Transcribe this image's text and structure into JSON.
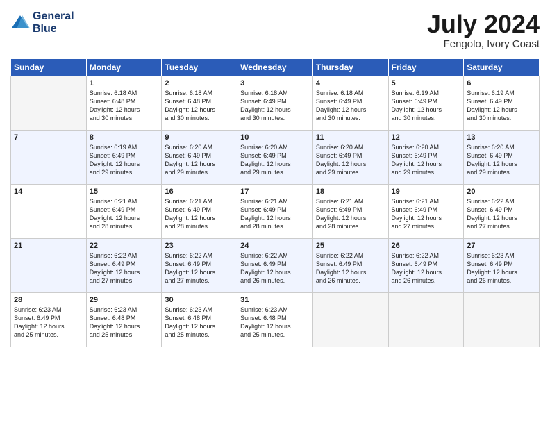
{
  "header": {
    "logo_line1": "General",
    "logo_line2": "Blue",
    "title": "July 2024",
    "location": "Fengolo, Ivory Coast"
  },
  "days_of_week": [
    "Sunday",
    "Monday",
    "Tuesday",
    "Wednesday",
    "Thursday",
    "Friday",
    "Saturday"
  ],
  "weeks": [
    [
      {
        "num": "",
        "info": ""
      },
      {
        "num": "1",
        "info": "Sunrise: 6:18 AM\nSunset: 6:48 PM\nDaylight: 12 hours\nand 30 minutes."
      },
      {
        "num": "2",
        "info": "Sunrise: 6:18 AM\nSunset: 6:48 PM\nDaylight: 12 hours\nand 30 minutes."
      },
      {
        "num": "3",
        "info": "Sunrise: 6:18 AM\nSunset: 6:49 PM\nDaylight: 12 hours\nand 30 minutes."
      },
      {
        "num": "4",
        "info": "Sunrise: 6:18 AM\nSunset: 6:49 PM\nDaylight: 12 hours\nand 30 minutes."
      },
      {
        "num": "5",
        "info": "Sunrise: 6:19 AM\nSunset: 6:49 PM\nDaylight: 12 hours\nand 30 minutes."
      },
      {
        "num": "6",
        "info": "Sunrise: 6:19 AM\nSunset: 6:49 PM\nDaylight: 12 hours\nand 30 minutes."
      }
    ],
    [
      {
        "num": "7",
        "info": ""
      },
      {
        "num": "8",
        "info": "Sunrise: 6:19 AM\nSunset: 6:49 PM\nDaylight: 12 hours\nand 29 minutes."
      },
      {
        "num": "9",
        "info": "Sunrise: 6:20 AM\nSunset: 6:49 PM\nDaylight: 12 hours\nand 29 minutes."
      },
      {
        "num": "10",
        "info": "Sunrise: 6:20 AM\nSunset: 6:49 PM\nDaylight: 12 hours\nand 29 minutes."
      },
      {
        "num": "11",
        "info": "Sunrise: 6:20 AM\nSunset: 6:49 PM\nDaylight: 12 hours\nand 29 minutes."
      },
      {
        "num": "12",
        "info": "Sunrise: 6:20 AM\nSunset: 6:49 PM\nDaylight: 12 hours\nand 29 minutes."
      },
      {
        "num": "13",
        "info": "Sunrise: 6:20 AM\nSunset: 6:49 PM\nDaylight: 12 hours\nand 29 minutes."
      }
    ],
    [
      {
        "num": "14",
        "info": ""
      },
      {
        "num": "15",
        "info": "Sunrise: 6:21 AM\nSunset: 6:49 PM\nDaylight: 12 hours\nand 28 minutes."
      },
      {
        "num": "16",
        "info": "Sunrise: 6:21 AM\nSunset: 6:49 PM\nDaylight: 12 hours\nand 28 minutes."
      },
      {
        "num": "17",
        "info": "Sunrise: 6:21 AM\nSunset: 6:49 PM\nDaylight: 12 hours\nand 28 minutes."
      },
      {
        "num": "18",
        "info": "Sunrise: 6:21 AM\nSunset: 6:49 PM\nDaylight: 12 hours\nand 28 minutes."
      },
      {
        "num": "19",
        "info": "Sunrise: 6:21 AM\nSunset: 6:49 PM\nDaylight: 12 hours\nand 27 minutes."
      },
      {
        "num": "20",
        "info": "Sunrise: 6:22 AM\nSunset: 6:49 PM\nDaylight: 12 hours\nand 27 minutes."
      }
    ],
    [
      {
        "num": "21",
        "info": ""
      },
      {
        "num": "22",
        "info": "Sunrise: 6:22 AM\nSunset: 6:49 PM\nDaylight: 12 hours\nand 27 minutes."
      },
      {
        "num": "23",
        "info": "Sunrise: 6:22 AM\nSunset: 6:49 PM\nDaylight: 12 hours\nand 27 minutes."
      },
      {
        "num": "24",
        "info": "Sunrise: 6:22 AM\nSunset: 6:49 PM\nDaylight: 12 hours\nand 26 minutes."
      },
      {
        "num": "25",
        "info": "Sunrise: 6:22 AM\nSunset: 6:49 PM\nDaylight: 12 hours\nand 26 minutes."
      },
      {
        "num": "26",
        "info": "Sunrise: 6:22 AM\nSunset: 6:49 PM\nDaylight: 12 hours\nand 26 minutes."
      },
      {
        "num": "27",
        "info": "Sunrise: 6:23 AM\nSunset: 6:49 PM\nDaylight: 12 hours\nand 26 minutes."
      }
    ],
    [
      {
        "num": "28",
        "info": "Sunrise: 6:23 AM\nSunset: 6:49 PM\nDaylight: 12 hours\nand 25 minutes."
      },
      {
        "num": "29",
        "info": "Sunrise: 6:23 AM\nSunset: 6:48 PM\nDaylight: 12 hours\nand 25 minutes."
      },
      {
        "num": "30",
        "info": "Sunrise: 6:23 AM\nSunset: 6:48 PM\nDaylight: 12 hours\nand 25 minutes."
      },
      {
        "num": "31",
        "info": "Sunrise: 6:23 AM\nSunset: 6:48 PM\nDaylight: 12 hours\nand 25 minutes."
      },
      {
        "num": "",
        "info": ""
      },
      {
        "num": "",
        "info": ""
      },
      {
        "num": "",
        "info": ""
      }
    ]
  ]
}
